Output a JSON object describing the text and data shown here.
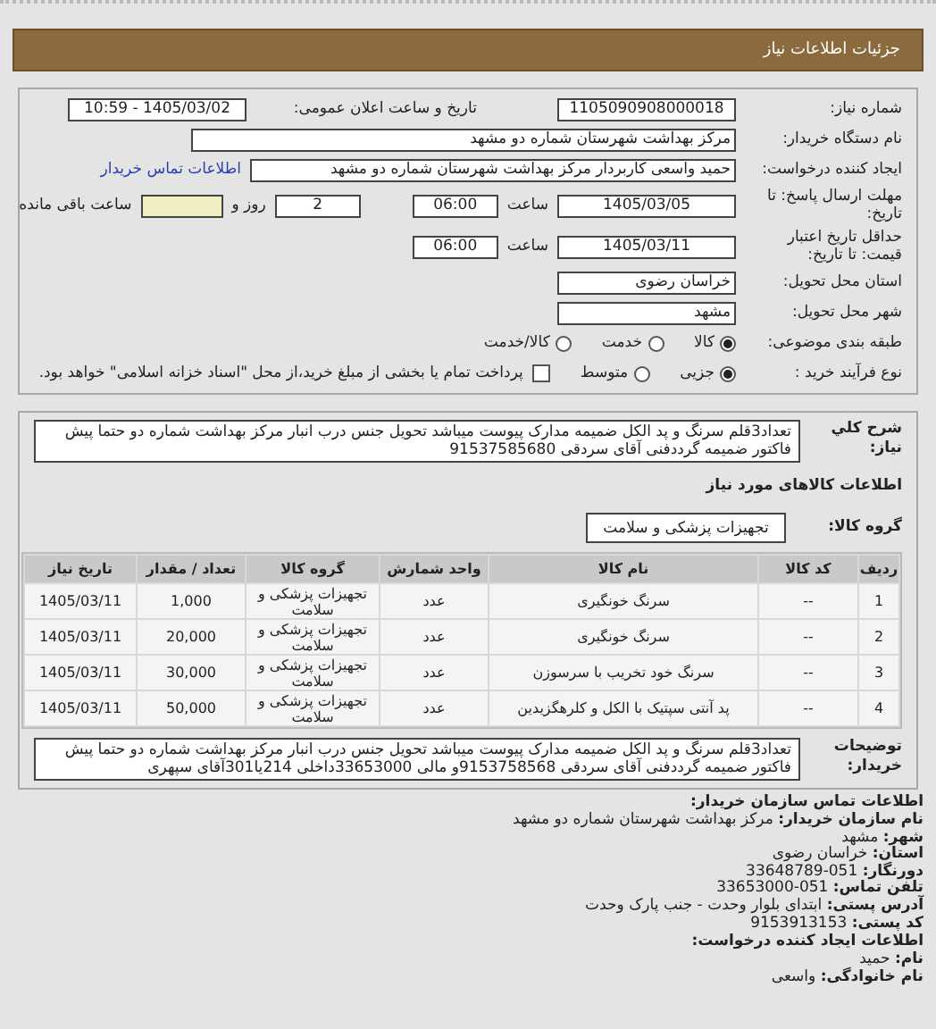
{
  "header": {
    "title": "جزئيات اطلاعات نياز"
  },
  "need_number": {
    "label": "شماره نیاز:",
    "value": "1105090908000018"
  },
  "announce": {
    "label": "تاریخ و ساعت اعلان عمومی:",
    "value": "1405/03/02 - 10:59"
  },
  "buyer": {
    "label": "نام دستگاه خریدار:",
    "value": "مرکز بهداشت شهرستان شماره دو مشهد"
  },
  "creator": {
    "label": "ایجاد کننده درخواست:",
    "value": "حمید واسعی کاربردار مرکز بهداشت شهرستان شماره دو مشهد",
    "link": "اطلاعات تماس خریدار"
  },
  "deadline": {
    "label": "مهلت ارسال پاسخ: تا تاریخ:",
    "date": "1405/03/05",
    "time_label": "ساعت",
    "time": "06:00",
    "days": "2",
    "days_label": "روز و",
    "remaining_label": "ساعت باقی مانده"
  },
  "validity": {
    "label": "حداقل تاریخ اعتبار قیمت: تا تاریخ:",
    "date": "1405/03/11",
    "time_label": "ساعت",
    "time": "06:00"
  },
  "province": {
    "label": "استان محل تحویل:",
    "value": "خراسان رضوی"
  },
  "city": {
    "label": "شهر محل تحویل:",
    "value": "مشهد"
  },
  "category": {
    "label": "طبقه بندی موضوعی:",
    "options": [
      {
        "label": "کالا",
        "selected": true
      },
      {
        "label": "خدمت",
        "selected": false
      },
      {
        "label": "کالا/خدمت",
        "selected": false
      }
    ]
  },
  "purchase_type": {
    "label": "نوع فرآیند خرید :",
    "options": [
      {
        "label": "جزیی",
        "selected": true
      },
      {
        "label": "متوسط",
        "selected": false
      }
    ],
    "payment": {
      "checked": false,
      "text": "پرداخت تمام یا بخشی از مبلغ خرید،از محل \"اسناد خزانه اسلامی\" خواهد بود."
    }
  },
  "summary": {
    "label": "شرح کلي نياز:",
    "text": "تعداد3قلم سرنگ و پد الکل ضمیمه مدارک پیوست میباشد تحویل جنس درب انبار مرکز بهداشت شماره دو حتما پیش فاکتور ضمیمه گرددفنی آقای سردقی 91537585680"
  },
  "goods": {
    "title": "اطلاعات کالاهای مورد نیاز",
    "group_label": "گروه کالا:",
    "group": "تجهیزات پزشکی و سلامت",
    "columns": [
      "ردیف",
      "کد کالا",
      "نام کالا",
      "واحد شمارش",
      "گروه کالا",
      "تعداد / مقدار",
      "تاریخ نیاز"
    ],
    "rows": [
      [
        "1",
        "--",
        "سرنگ خونگیری",
        "عدد",
        "تجهیزات پزشکی و سلامت",
        "1,000",
        "1405/03/11"
      ],
      [
        "2",
        "--",
        "سرنگ خونگیری",
        "عدد",
        "تجهیزات پزشکی و سلامت",
        "20,000",
        "1405/03/11"
      ],
      [
        "3",
        "--",
        "سرنگ خود تخریب با سرسوزن",
        "عدد",
        "تجهیزات پزشکی و سلامت",
        "30,000",
        "1405/03/11"
      ],
      [
        "4",
        "--",
        "پد آنتی سپتیک با الکل و کلرهگزیدین",
        "عدد",
        "تجهیزات پزشکی و سلامت",
        "50,000",
        "1405/03/11"
      ]
    ]
  },
  "notes": {
    "label": "توضیحات خریدار:",
    "text": "تعداد3قلم سرنگ و پد الکل ضمیمه مدارک پیوست میباشد تحویل جنس درب انبار مرکز بهداشت شماره دو حتما پیش فاکتور ضمیمه گرددفنی آقای سردقی 9153758568و مالی 33653000داخلی 214یا301آقای سپهری"
  },
  "contact": {
    "title": "اطلاعات تماس سازمان خریدار:",
    "lines": [
      {
        "label": "نام سازمان خریدار:",
        "value": "مرکز بهداشت شهرستان شماره دو مشهد"
      },
      {
        "label": "شهر:",
        "value": "مشهد"
      },
      {
        "label": "استان:",
        "value": "خراسان رضوی"
      },
      {
        "label": "دورنگار:",
        "value": "051-33648789"
      },
      {
        "label": "تلفن تماس:",
        "value": "051-33653000"
      },
      {
        "label": "آدرس پستی:",
        "value": "ابتدای بلوار وحدت - جنب پارک وحدت"
      },
      {
        "label": "کد پستی:",
        "value": "9153913153"
      }
    ]
  },
  "creator_info": {
    "title": "اطلاعات ایجاد کننده درخواست:",
    "lines": [
      {
        "label": "نام:",
        "value": "حمید"
      },
      {
        "label": "نام خانوادگی:",
        "value": "واسعی"
      }
    ]
  }
}
